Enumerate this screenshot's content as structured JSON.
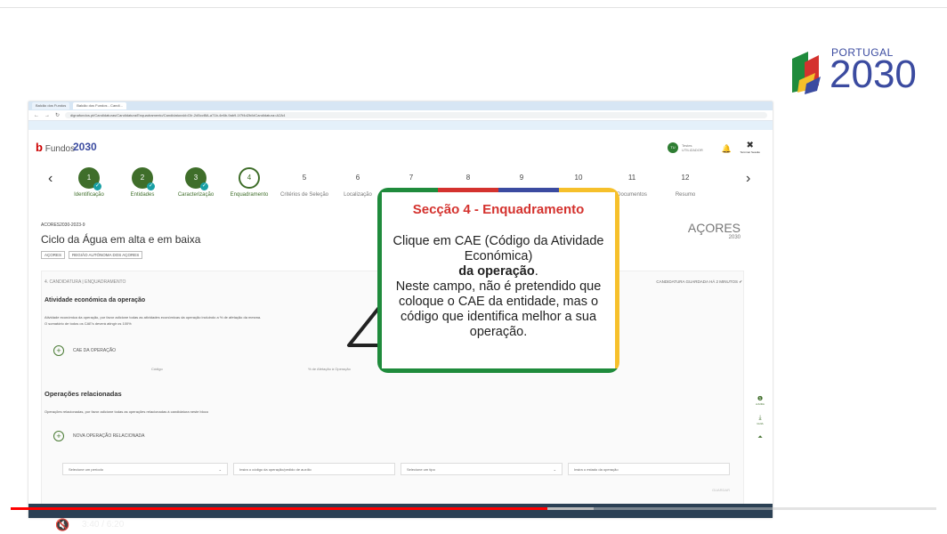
{
  "brand": {
    "portugal": "PORTUGAL",
    "year": "2030"
  },
  "browser": {
    "tabs": [
      "Balcão dos Fundos",
      "Balcão dos Fundos - Candi..."
    ],
    "url": "dignafundos.pt/Candidaturas/Candidatura/Enquadramento/CandidaturaId=DIr-2d5ccf8A-a71b-4e6b-9ab9-1f7f4d2b/idCandidatura=A2A4"
  },
  "app": {
    "logo_small": "Balcão dos",
    "logo_main": "Fundos",
    "logo_2030": "2030",
    "user_initials": "TU",
    "user_name": "Testes UTILIZADOR",
    "logout": "Terminar Sessão"
  },
  "stepper": {
    "steps": [
      {
        "num": "1",
        "label": "Identificação",
        "state": "done"
      },
      {
        "num": "2",
        "label": "Entidades",
        "state": "done"
      },
      {
        "num": "3",
        "label": "Caracterização",
        "state": "done"
      },
      {
        "num": "4",
        "label": "Enquadramento",
        "state": "current"
      },
      {
        "num": "5",
        "label": "Critérios de Seleção",
        "state": "todo"
      },
      {
        "num": "6",
        "label": "Localização",
        "state": "todo"
      },
      {
        "num": "7",
        "label": "",
        "state": "todo"
      },
      {
        "num": "8",
        "label": "",
        "state": "todo"
      },
      {
        "num": "9",
        "label": "",
        "state": "todo"
      },
      {
        "num": "10",
        "label": "",
        "state": "todo"
      },
      {
        "num": "11",
        "label": "Documentos",
        "state": "todo"
      },
      {
        "num": "12",
        "label": "Resumo",
        "state": "todo"
      }
    ]
  },
  "page": {
    "ref": "ACORES2030-2023-9",
    "title": "Ciclo da Água em alta e em baixa",
    "tags": [
      "AÇORES",
      "REGIÃO AUTÓNOMA DOS AÇORES"
    ],
    "program": "AÇORES",
    "program_year": "2030",
    "section_label": "4. CANDIDATURA | ENQUADRAMENTO",
    "saved": "CANDIDATURA GUARDADA HÁ 2 MINUTOS ✔",
    "activity_heading": "Atividade económica da operação",
    "activity_text1": "Atividade económica da operação, por favor adicione todas as atividades económicas da operação incluindo a % de afetação da mesma.",
    "activity_text2": "O somatório de todos os CAE's deverá atingir os 100%",
    "cae_add": "CAE DA OPERAÇÃO",
    "col_code": "Código",
    "col_pct": "% de Afetação à Operação",
    "related_heading": "Operações relacionadas",
    "related_text": "Operações relacionadas, por favor adicione todas as operações relacionadas à candidatura neste bloco",
    "related_add": "NOVA OPERAÇÃO RELACIONADA",
    "filter_period": "Selecione um período",
    "filter_code": "Insira o código da operação/pedido de auxílio",
    "filter_type": "Selecione um tipo",
    "filter_state": "Insira o estado da operação",
    "save_btn": "GUARDAR",
    "side_help": "AJUDA",
    "side_guide": "GUIA"
  },
  "callout": {
    "title": "Secção 4 - Enquadramento",
    "line1": "Clique em CAE (Código da Atividade Económica)",
    "bold": "da operação",
    "line2": "Neste campo, não é pretendido que coloque o CAE da entidade, mas o código que identifica melhor a sua operação."
  },
  "video": {
    "time": "3:40 / 6:20",
    "progress": 0.58,
    "buffered": 0.63
  },
  "colors": {
    "red": "#d4322e",
    "green": "#1f8b3c",
    "yellow": "#f6c02b",
    "blue": "#3b4ba0"
  }
}
